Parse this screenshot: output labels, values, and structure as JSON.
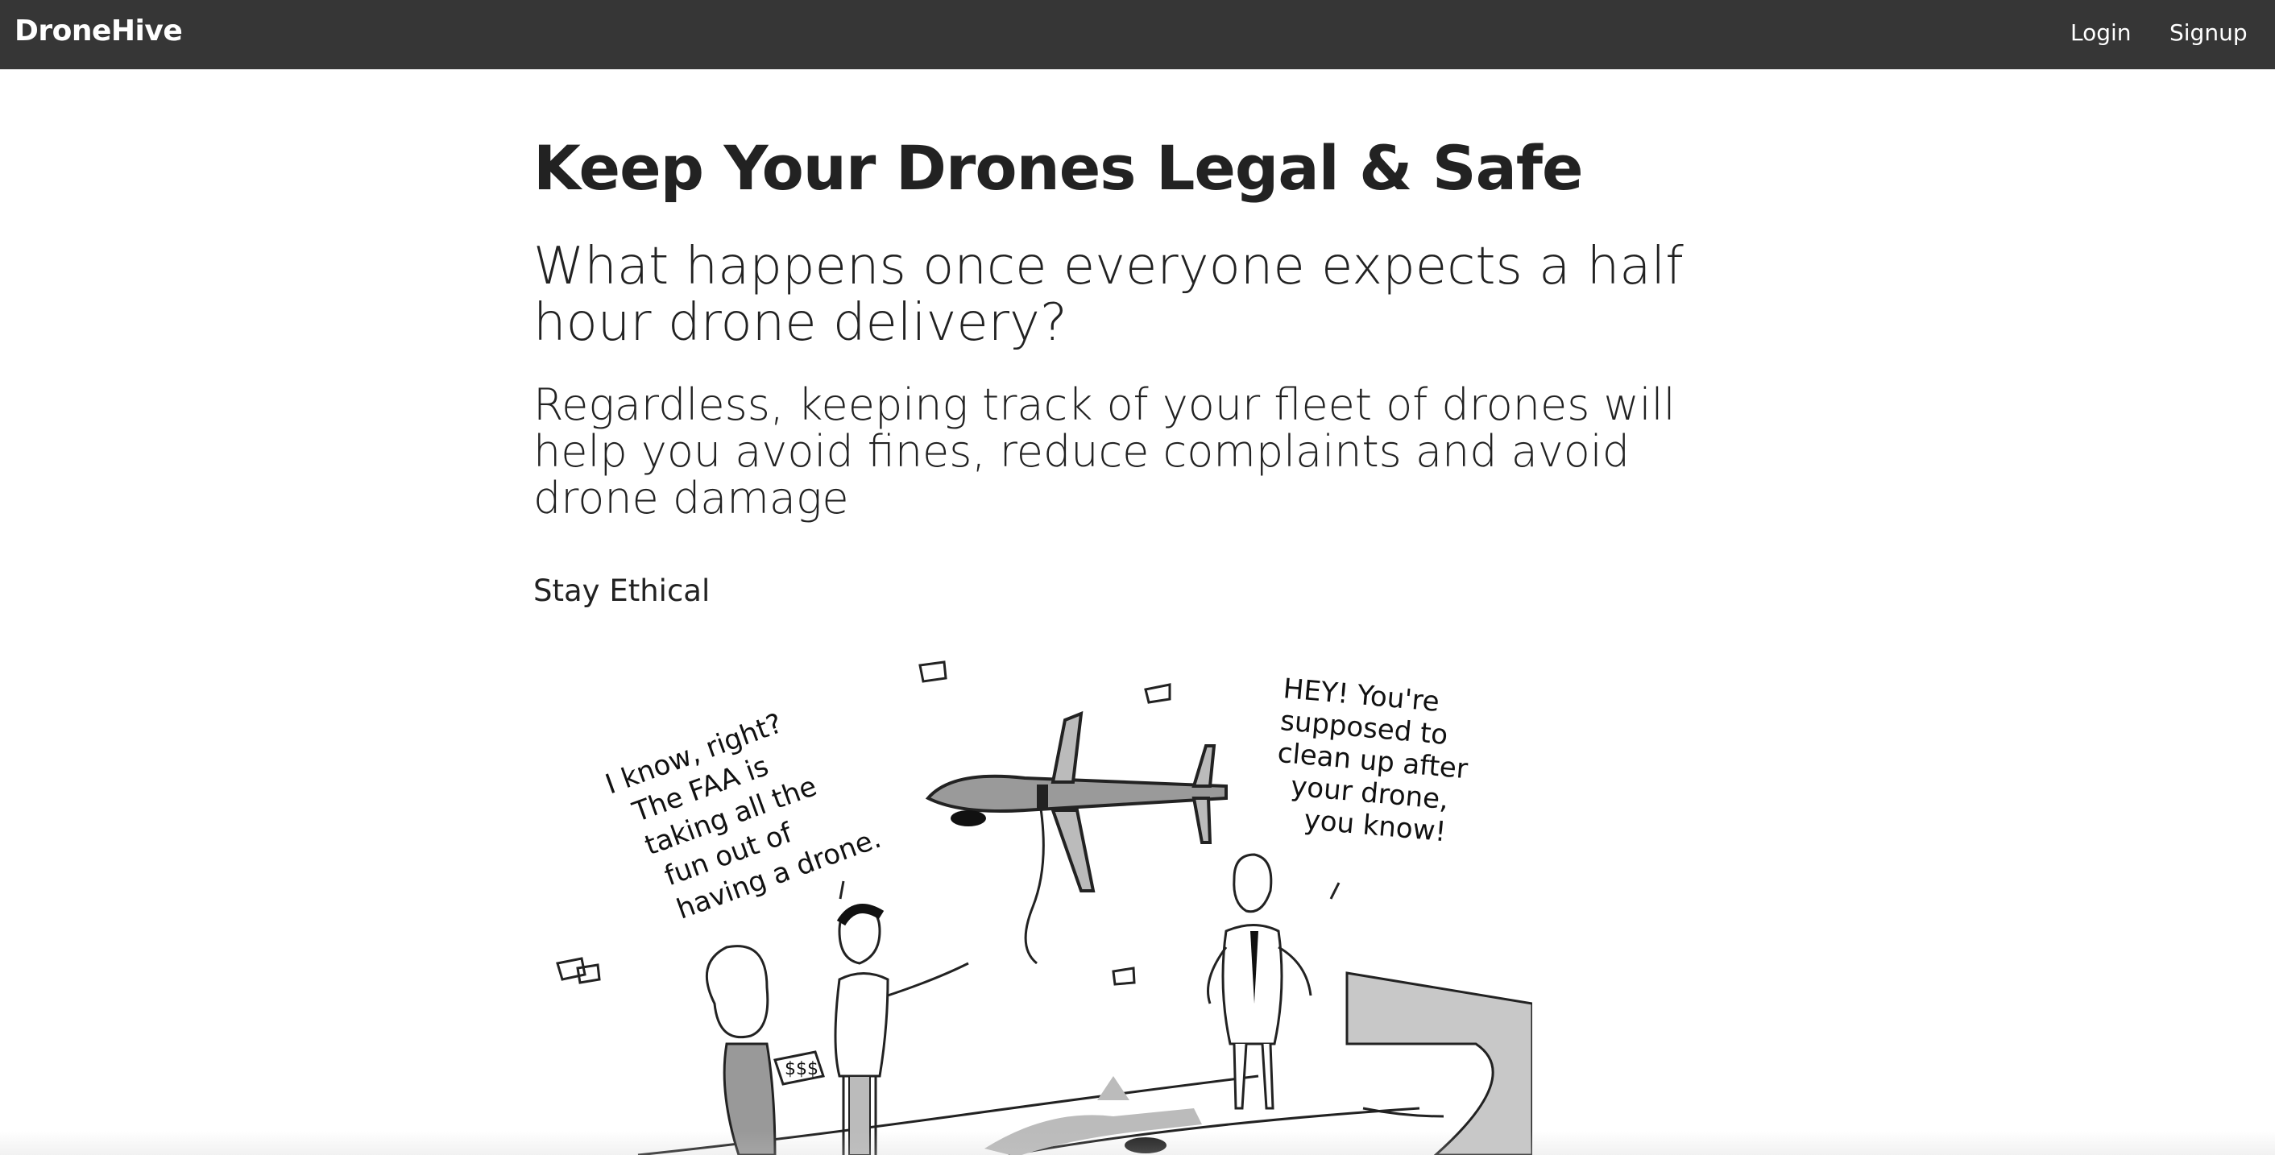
{
  "navbar": {
    "brand": "DroneHive",
    "login": "Login",
    "signup": "Signup"
  },
  "hero": {
    "title": "Keep Your Drones Legal & Safe",
    "subtitle": "What happens once everyone expects a half hour drone delivery?",
    "body": "Regardless, keeping track of your fleet of drones will help you avoid fines, reduce complaints and avoid drone damage"
  },
  "section": {
    "label": "Stay Ethical"
  },
  "cartoon": {
    "bubble_left": [
      "I know, right?",
      "The FAA is",
      "taking all the",
      "fun out of",
      "having a drone."
    ],
    "bubble_right": [
      "HEY! You're",
      "supposed to",
      "clean up after",
      "your drone,",
      "you know!"
    ]
  }
}
